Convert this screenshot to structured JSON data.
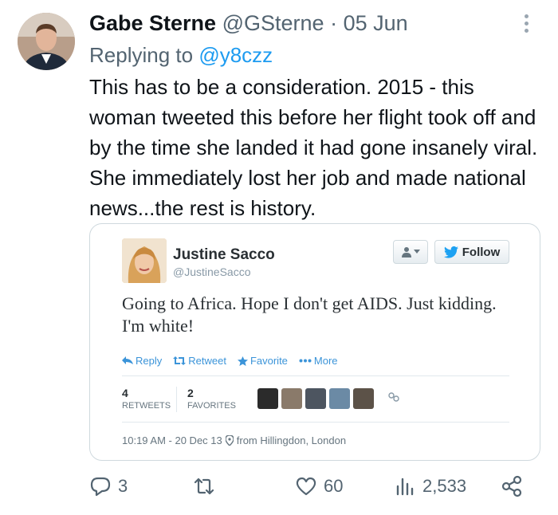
{
  "tweet": {
    "author_name": "Gabe Sterne",
    "author_handle": "@GSterne",
    "separator": "·",
    "date": "05 Jun",
    "replying_to_prefix": "Replying to",
    "replying_to_handle": "@y8czz",
    "text": "This has to be a consideration. 2015 - this woman tweeted this before her flight took off and by the time she landed it had gone insanely viral. She immediately lost her job and made national news...the rest is history."
  },
  "embedded": {
    "name": "Justine Sacco",
    "handle": "@JustineSacco",
    "follow_label": "Follow",
    "text": "Going to Africa. Hope I don't get AIDS. Just kidding. I'm white!",
    "actions": {
      "reply": "Reply",
      "retweet": "Retweet",
      "favorite": "Favorite",
      "more": "More"
    },
    "retweets_count": "4",
    "retweets_label": "RETWEETS",
    "favorites_count": "2",
    "favorites_label": "FAVORITES",
    "timestamp": "10:19 AM - 20 Dec 13",
    "location": "from Hillingdon, London"
  },
  "action_bar": {
    "replies": "3",
    "retweets": "",
    "likes": "60",
    "views": "2,533"
  },
  "colors": {
    "link_blue": "#1d9bf0",
    "muted_gray": "#536471",
    "legacy_blue": "#3b94d9",
    "twitter_bird": "#1da1f2"
  },
  "icons": [
    "more-vertical-icon",
    "person-icon",
    "chevron-down-icon",
    "bird-icon",
    "reply-icon",
    "retweet-icon",
    "star-icon",
    "more-dots-icon",
    "location-pin-icon",
    "comment-icon",
    "heart-icon",
    "views-icon",
    "share-icon"
  ]
}
